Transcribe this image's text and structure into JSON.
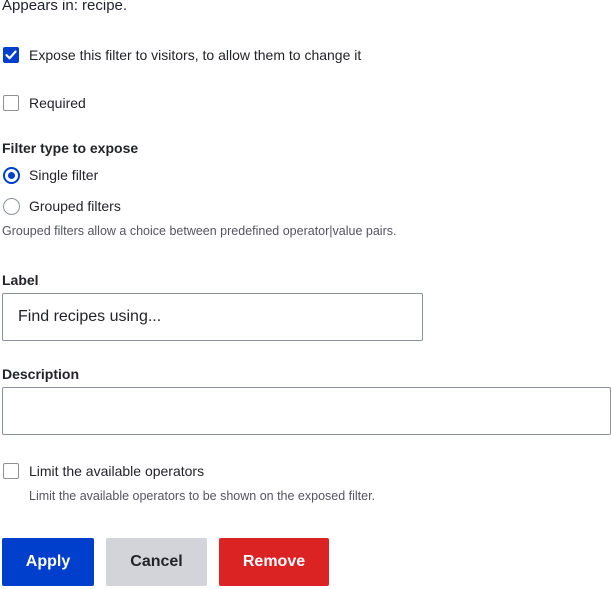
{
  "appears_in": "Appears in: recipe.",
  "expose": {
    "label": "Expose this filter to visitors, to allow them to change it",
    "checked": true
  },
  "required": {
    "label": "Required",
    "checked": false
  },
  "filter_type": {
    "heading": "Filter type to expose",
    "options": [
      {
        "label": "Single filter",
        "selected": true
      },
      {
        "label": "Grouped filters",
        "selected": false
      }
    ],
    "description": "Grouped filters allow a choice between predefined operator|value pairs."
  },
  "label_field": {
    "label": "Label",
    "value": "Find recipes using..."
  },
  "description_field": {
    "label": "Description",
    "value": ""
  },
  "limit_operators": {
    "label": "Limit the available operators",
    "checked": false,
    "description": "Limit the available operators to be shown on the exposed filter."
  },
  "buttons": {
    "apply": "Apply",
    "cancel": "Cancel",
    "remove": "Remove"
  },
  "colors": {
    "primary": "#003ecc",
    "danger": "#dc2323",
    "secondary": "#d3d4d9"
  },
  "icons": {
    "checkmark": "checkmark-icon"
  }
}
